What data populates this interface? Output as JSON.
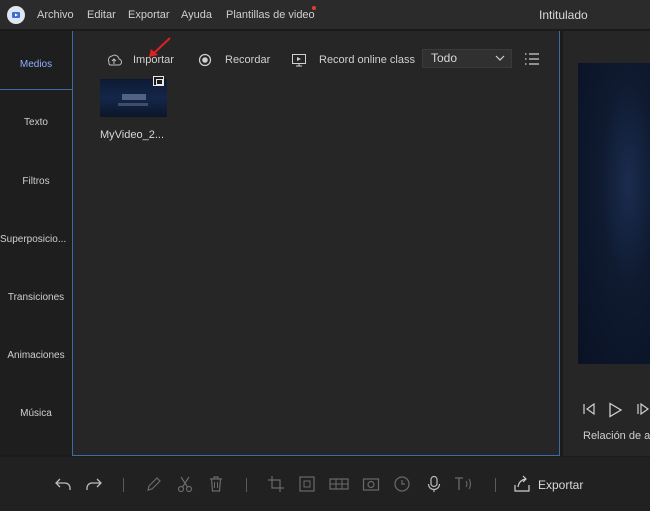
{
  "app": {
    "title": "Intitulado"
  },
  "menu": {
    "items": [
      "Archivo",
      "Editar",
      "Exportar",
      "Ayuda",
      "Plantillas de video"
    ]
  },
  "sidenav": {
    "items": [
      "Medios",
      "Texto",
      "Filtros",
      "Superposicio...",
      "Transiciones",
      "Animaciones",
      "Música"
    ],
    "active": "Medios"
  },
  "toolbar": {
    "import_label": "Importar",
    "record_label": "Recordar",
    "online_class_label": "Record online class",
    "filter_value": "Todo"
  },
  "media": {
    "items": [
      {
        "name": "MyVideo_2..."
      }
    ]
  },
  "preview": {
    "ratio_label": "Relación de a"
  },
  "bottom": {
    "export_label": "Exportar"
  },
  "colors": {
    "accent": "#3f6aa8",
    "active_nav": "#8ab0ff",
    "arrow": "#e02020"
  }
}
